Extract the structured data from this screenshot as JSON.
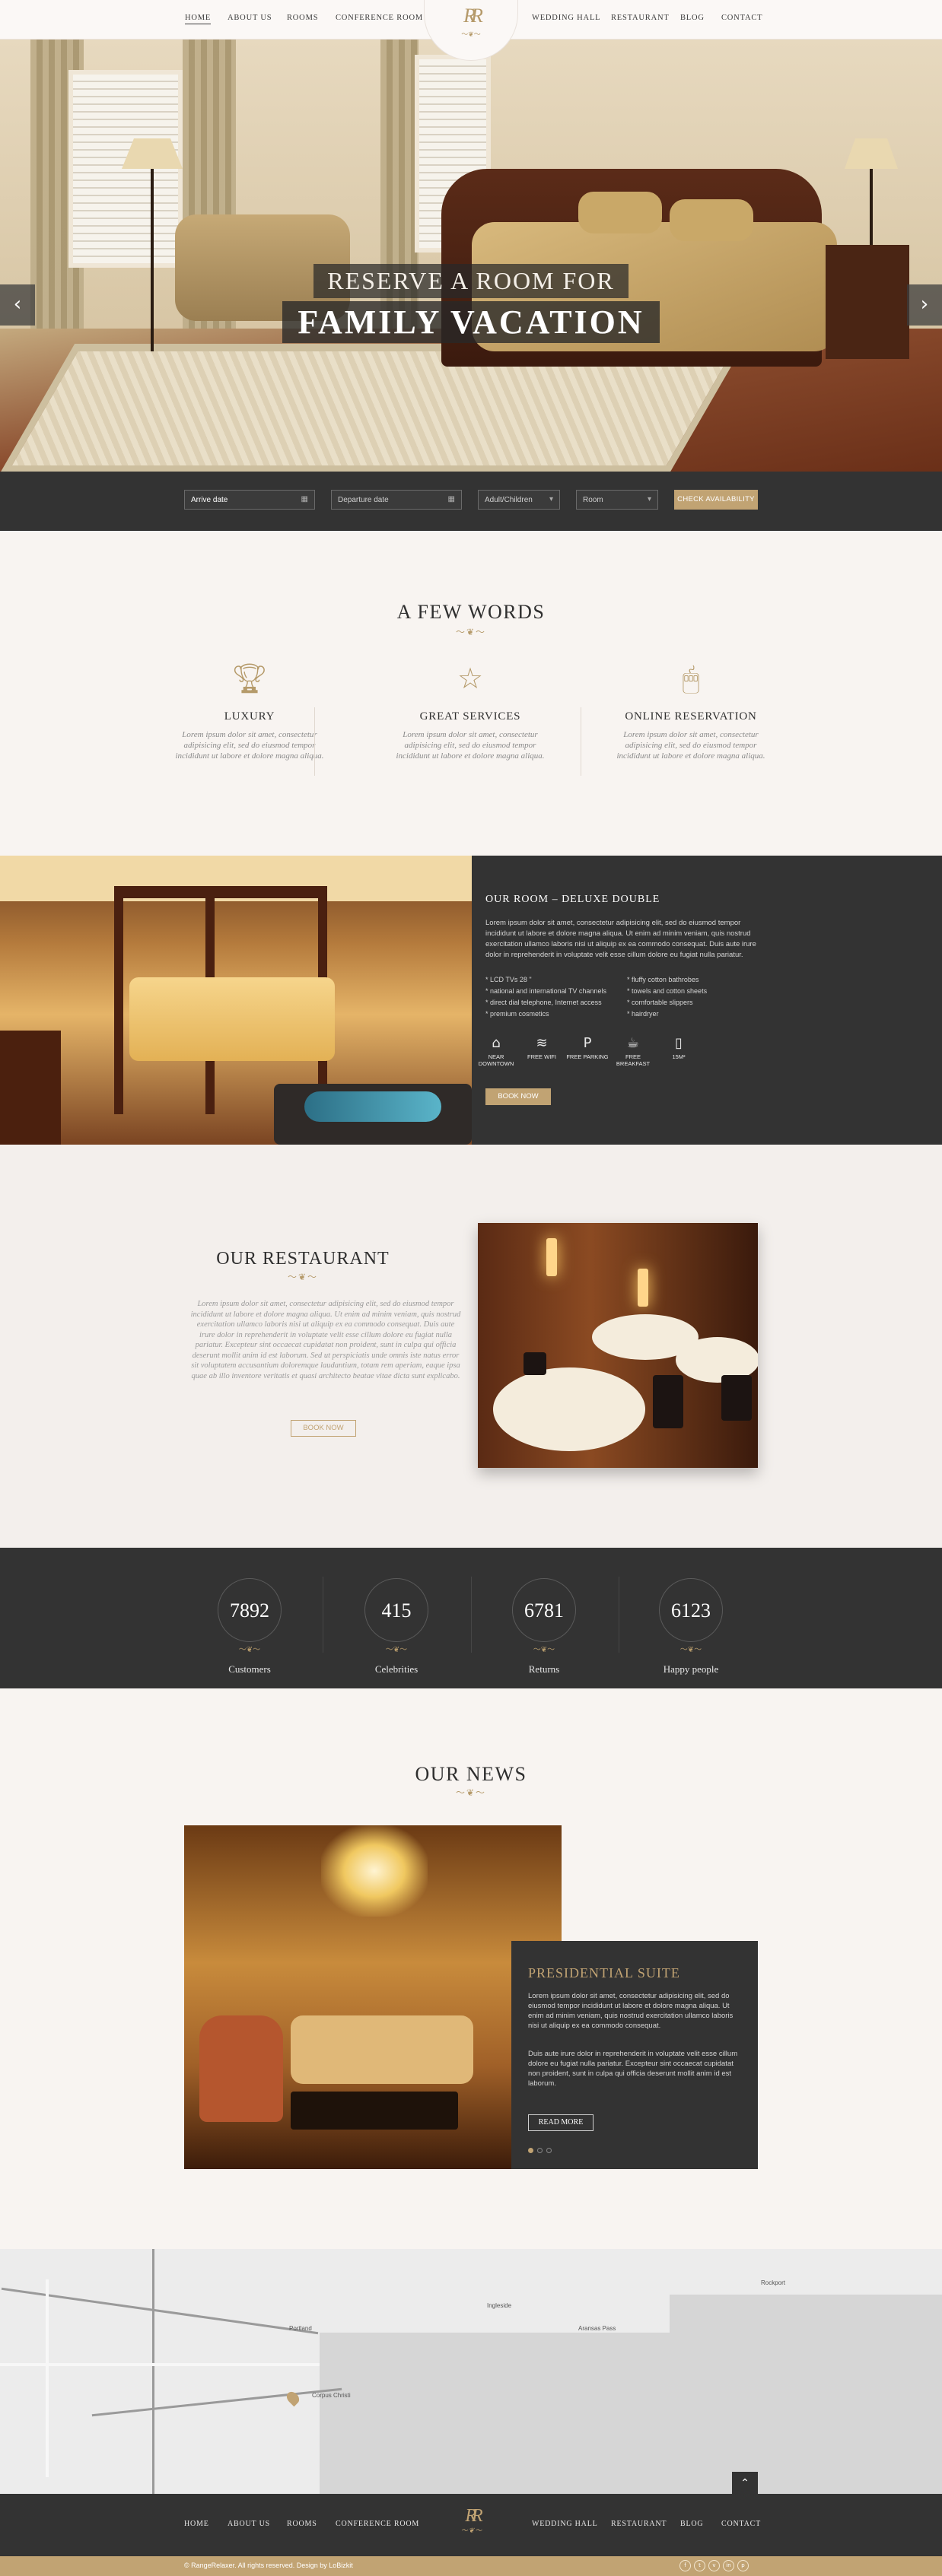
{
  "nav": {
    "items": [
      "HOME",
      "ABOUT US",
      "ROOMS",
      "CONFERENCE ROOM",
      "WEDDING HALL",
      "RESTAURANT",
      "BLOG",
      "CONTACT"
    ],
    "logo_monogram": "RR"
  },
  "hero": {
    "line1": "RESERVE A ROOM FOR",
    "line2": "FAMILY VACATION",
    "prev_icon": "chevron-left-icon",
    "next_icon": "chevron-right-icon"
  },
  "booking": {
    "arrive": "Arrive date",
    "departure": "Departure date",
    "guests": "Adult/Children",
    "room": "Room",
    "button": "CHECK AVAILABILITY"
  },
  "words": {
    "title": "A FEW WORDS",
    "items": [
      {
        "icon": "trophy-icon",
        "title": "LUXURY",
        "text": "Lorem ipsum dolor sit amet, consectetur adipisicing elit, sed do eiusmod tempor incididunt ut labore et dolore magna aliqua."
      },
      {
        "icon": "star-icon",
        "title": "GREAT SERVICES",
        "text": "Lorem ipsum dolor sit amet, consectetur adipisicing elit, sed do eiusmod tempor incididunt ut labore et dolore magna aliqua."
      },
      {
        "icon": "mouse-icon",
        "title": "ONLINE RESERVATION",
        "text": "Lorem ipsum dolor sit amet, consectetur adipisicing elit, sed do eiusmod tempor incididunt ut labore et dolore magna aliqua."
      }
    ]
  },
  "room": {
    "title": "OUR ROOM – DELUXE DOUBLE",
    "desc": "Lorem ipsum dolor sit amet, consectetur adipisicing elit, sed do eiusmod tempor incididunt ut labore et dolore magna aliqua. Ut enim ad minim veniam, quis nostrud exercitation ullamco laboris nisi ut aliquip ex ea commodo consequat. Duis aute irure dolor in reprehenderit in voluptate velit esse cillum dolore eu fugiat nulla pariatur.",
    "features_left": [
      "* LCD TVs 28 \"",
      "* national and international TV channels",
      "* direct dial telephone, Internet access",
      "* premium cosmetics"
    ],
    "features_right": [
      "* fluffy cotton bathrobes",
      "* towels and cotton sheets",
      "* comfortable slippers",
      "* hairdryer"
    ],
    "amenities": [
      {
        "icon": "building-icon",
        "label": "NEAR DOWNTOWN"
      },
      {
        "icon": "wifi-icon",
        "label": "FREE WIFI"
      },
      {
        "icon": "parking-icon",
        "label": "FREE PARKING"
      },
      {
        "icon": "coffee-icon",
        "label": "FREE BREAKFAST"
      },
      {
        "icon": "phone-icon",
        "label": "15M²"
      }
    ],
    "button": "BOOK NOW"
  },
  "restaurant": {
    "title": "OUR RESTAURANT",
    "text": "Lorem ipsum dolor sit amet, consectetur adipisicing elit, sed do eiusmod tempor incididunt ut labore et dolore magna aliqua. Ut enim ad minim veniam, quis nostrud exercitation ullamco laboris nisi ut aliquip ex ea commodo consequat. Duis aute irure dolor in reprehenderit in voluptate velit esse cillum dolore eu fugiat nulla pariatur. Excepteur sint occaecat cupidatat non proident, sunt in culpa qui officia deserunt mollit anim id est laborum. Sed ut perspiciatis unde omnis iste natus error sit voluptatem accusantium doloremque laudantium, totam rem aperiam, eaque ipsa quae ab illo inventore veritatis et quasi architecto beatae vitae dicta sunt explicabo.",
    "button": "BOOK NOW"
  },
  "stats": [
    {
      "value": "7892",
      "label": "Customers"
    },
    {
      "value": "415",
      "label": "Celebrities"
    },
    {
      "value": "6781",
      "label": "Returns"
    },
    {
      "value": "6123",
      "label": "Happy people"
    }
  ],
  "news": {
    "title": "OUR NEWS",
    "card_title": "PRESIDENTIAL SUITE",
    "p1": "Lorem ipsum dolor sit amet, consectetur adipisicing elit, sed do eiusmod tempor incididunt ut labore et dolore magna aliqua. Ut enim ad minim veniam, quis nostrud exercitation ullamco laboris nisi ut aliquip ex ea commodo consequat.",
    "p2": "Duis aute irure dolor in reprehenderit in voluptate velit esse cillum dolore eu fugiat nulla pariatur. Excepteur sint occaecat cupidatat non proident, sunt in culpa qui officia deserunt mollit anim id est laborum.",
    "button": "READ MORE"
  },
  "map": {
    "labels": [
      "Corpus Christi",
      "Portland",
      "Ingleside",
      "Aransas Pass",
      "Rockport"
    ]
  },
  "footer": {
    "items": [
      "HOME",
      "ABOUT US",
      "ROOMS",
      "CONFERENCE ROOM",
      "WEDDING HALL",
      "RESTAURANT",
      "BLOG",
      "CONTACT"
    ],
    "copyright": "© RangeRelaxer. All rights reserved. Design by LoBizkit",
    "social": [
      "f",
      "t",
      "v",
      "in",
      "p"
    ]
  },
  "colors": {
    "accent": "#c1a373",
    "dark": "#333333",
    "light_bg": "#f8f4f1"
  }
}
